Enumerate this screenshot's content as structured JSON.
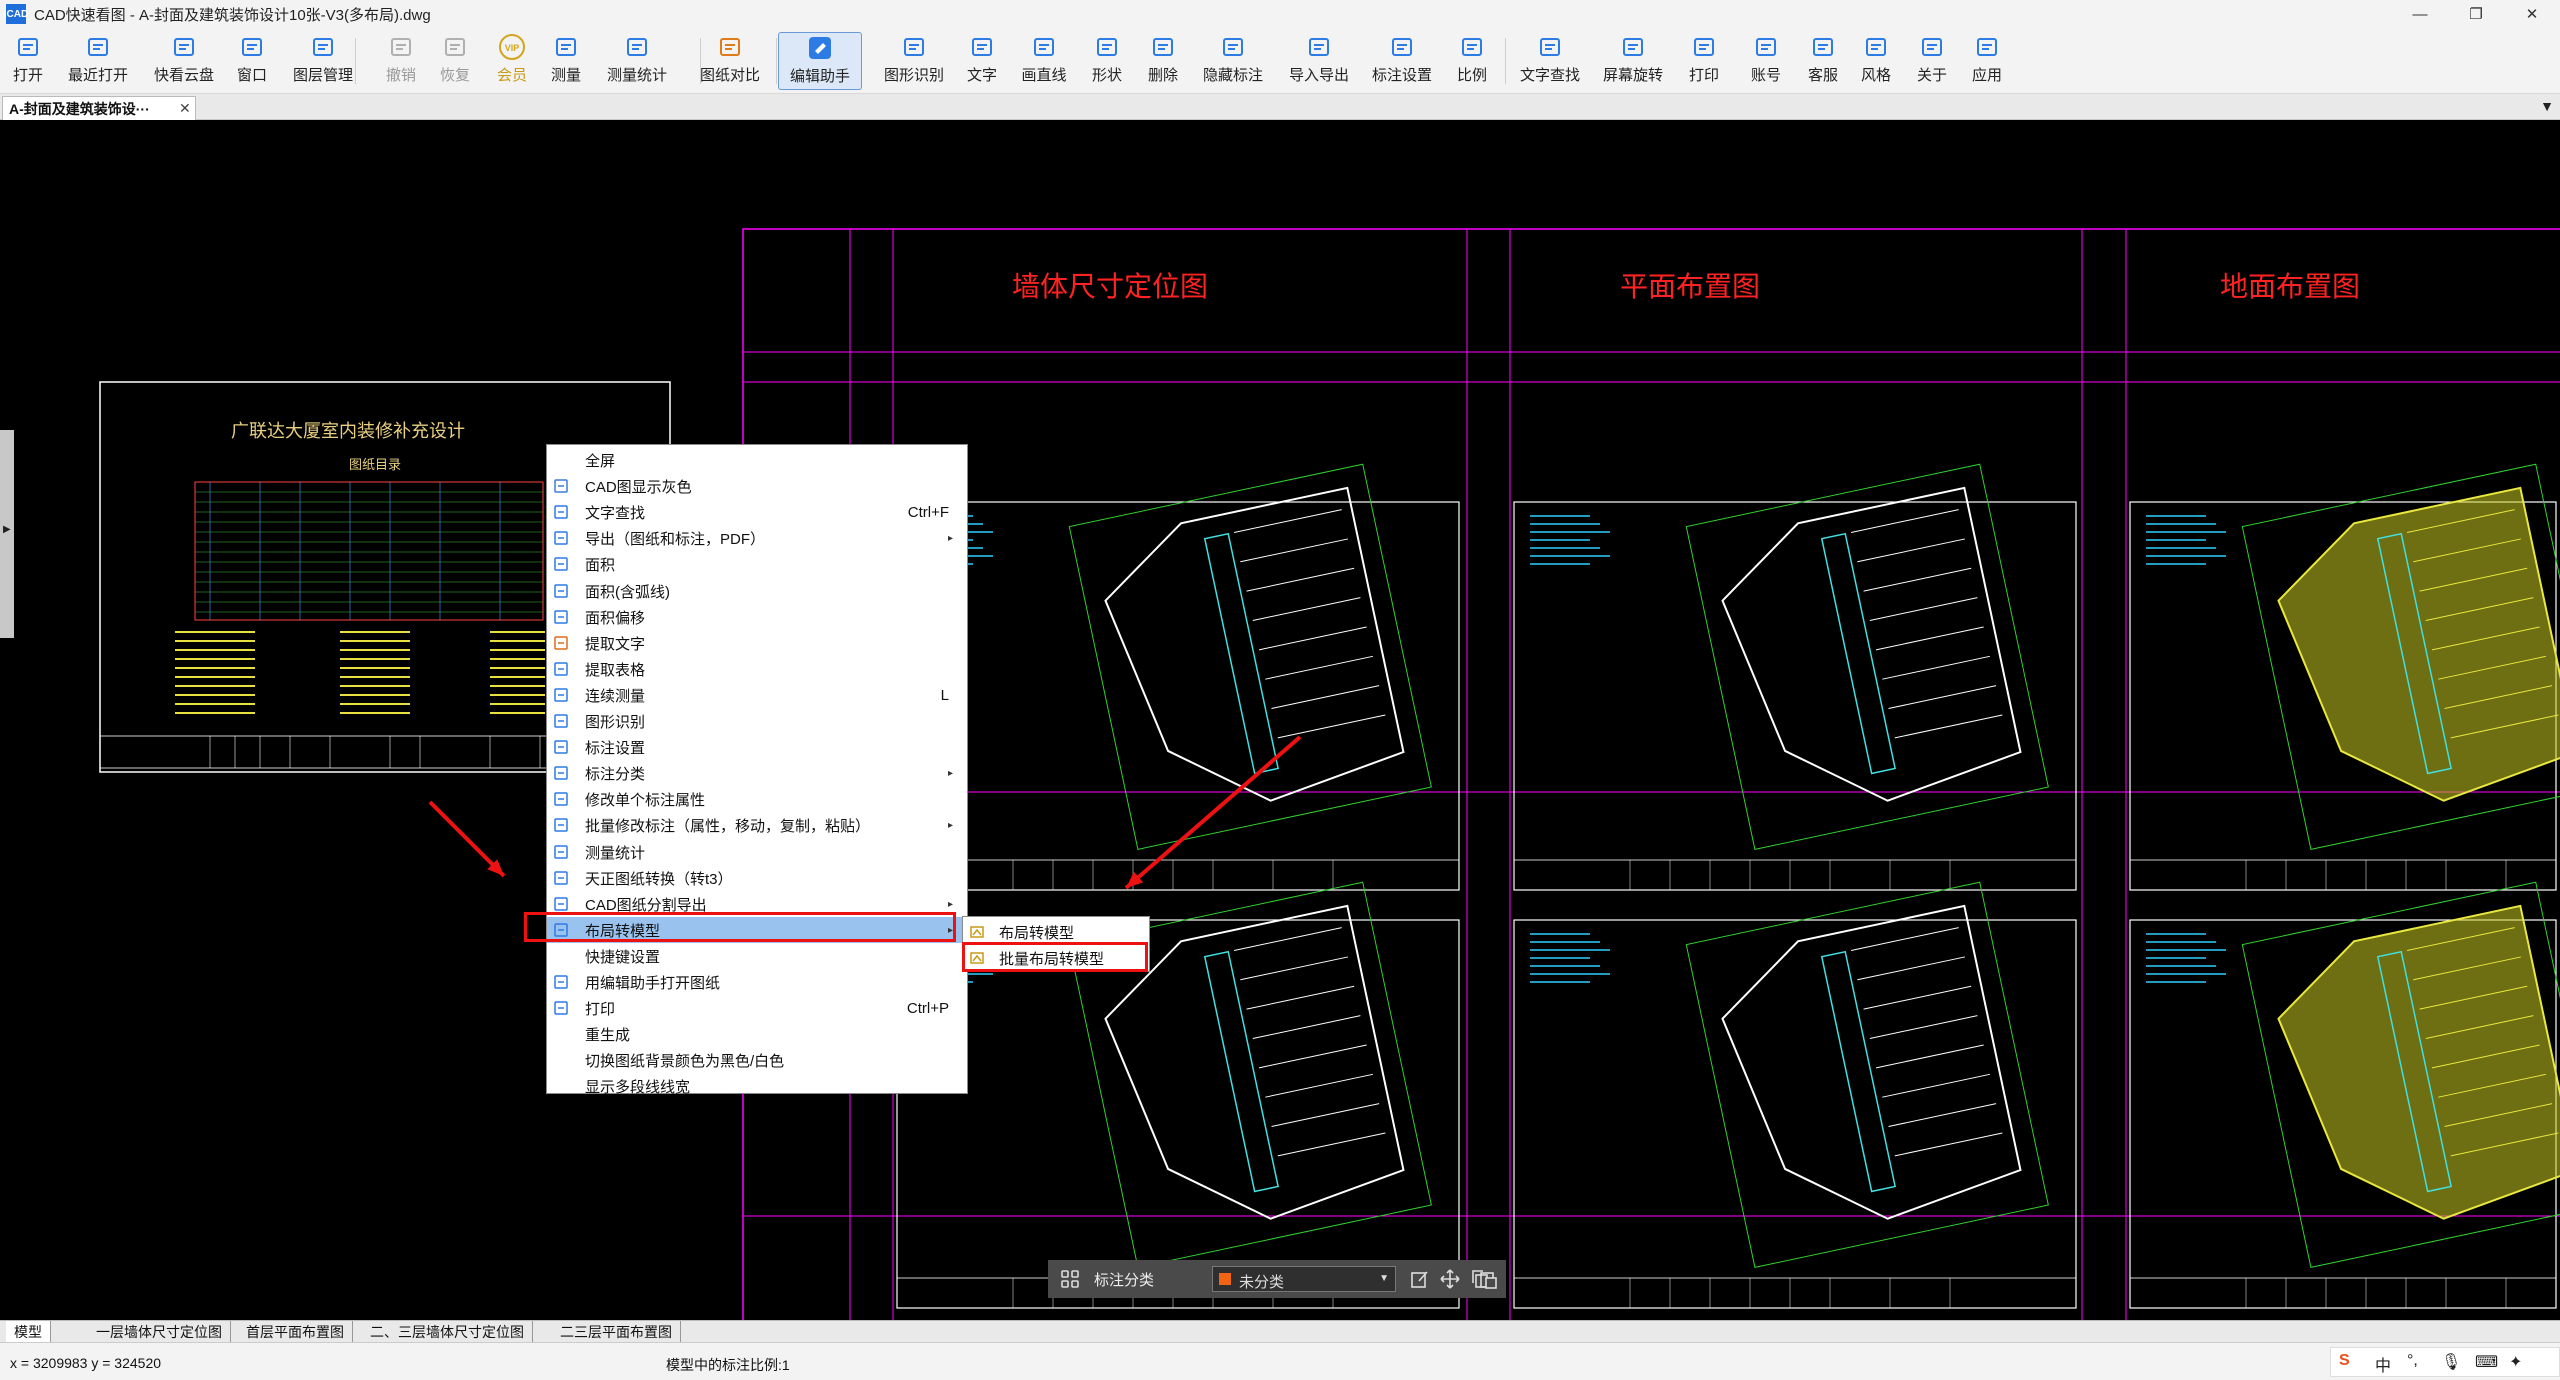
{
  "window": {
    "logo": "ICAD",
    "title": "CAD快速看图 - A-封面及建筑装饰设计10张-V3(多布局).dwg",
    "controls": [
      "—",
      "❐",
      "✕"
    ]
  },
  "toolbar": {
    "items": [
      {
        "label": "打开",
        "icon": "open-folder-icon"
      },
      {
        "label": "最近打开",
        "icon": "recent-icon"
      },
      {
        "label": "快看云盘",
        "icon": "cloud-icon"
      },
      {
        "label": "窗口",
        "icon": "window-icon"
      },
      {
        "label": "图层管理",
        "icon": "layers-icon"
      },
      {
        "label": "撤销",
        "icon": "undo-icon"
      },
      {
        "label": "恢复",
        "icon": "redo-icon"
      },
      {
        "label": "会员",
        "icon": "vip-icon"
      },
      {
        "label": "测量",
        "icon": "ruler-icon"
      },
      {
        "label": "测量统计",
        "icon": "measure-stats-icon"
      },
      {
        "label": "图纸对比",
        "icon": "compare-icon"
      },
      {
        "label": "编辑助手",
        "icon": "edit-assistant-icon"
      },
      {
        "label": "图形识别",
        "icon": "shape-recognize-icon"
      },
      {
        "label": "文字",
        "icon": "text-icon"
      },
      {
        "label": "画直线",
        "icon": "line-icon"
      },
      {
        "label": "形状",
        "icon": "shape-icon"
      },
      {
        "label": "删除",
        "icon": "eraser-icon"
      },
      {
        "label": "隐藏标注",
        "icon": "hide-annotation-icon"
      },
      {
        "label": "导入导出",
        "icon": "import-export-icon"
      },
      {
        "label": "标注设置",
        "icon": "annotation-settings-icon"
      },
      {
        "label": "比例",
        "icon": "scale-icon"
      },
      {
        "label": "文字查找",
        "icon": "text-search-icon"
      },
      {
        "label": "屏幕旋转",
        "icon": "rotate-screen-icon"
      },
      {
        "label": "打印",
        "icon": "print-icon"
      },
      {
        "label": "账号",
        "icon": "account-icon"
      },
      {
        "label": "客服",
        "icon": "headset-icon"
      },
      {
        "label": "风格",
        "icon": "style-icon"
      },
      {
        "label": "关于",
        "icon": "info-icon"
      },
      {
        "label": "应用",
        "icon": "apps-icon"
      }
    ]
  },
  "doc_tab": {
    "label": "A-封面及建筑装饰设···",
    "close": "✕"
  },
  "drawing": {
    "panel_titles": [
      "墙体尺寸定位图",
      "平面布置图",
      "地面布置图"
    ],
    "cover_title": "广联达大厦室内装修补充设计",
    "cover_subtitle": "图纸目录"
  },
  "context_menu": {
    "items": [
      {
        "label": "全屏",
        "shortcut": "",
        "submenu": false,
        "icon": ""
      },
      {
        "label": "CAD图显示灰色",
        "shortcut": "",
        "submenu": false,
        "icon": "cad-gray-icon"
      },
      {
        "label": "文字查找",
        "shortcut": "Ctrl+F",
        "submenu": false,
        "icon": "text-search-icon"
      },
      {
        "label": "导出（图纸和标注，PDF）",
        "shortcut": "",
        "submenu": true,
        "icon": "export-icon"
      },
      {
        "label": "面积",
        "shortcut": "",
        "submenu": false,
        "icon": "area-icon"
      },
      {
        "label": "面积(含弧线)",
        "shortcut": "",
        "submenu": false,
        "icon": "area-arc-icon"
      },
      {
        "label": "面积偏移",
        "shortcut": "",
        "submenu": false,
        "icon": "area-offset-icon"
      },
      {
        "label": "提取文字",
        "shortcut": "",
        "submenu": false,
        "icon": "extract-text-icon"
      },
      {
        "label": "提取表格",
        "shortcut": "",
        "submenu": false,
        "icon": "extract-table-icon"
      },
      {
        "label": "连续测量",
        "shortcut": "L",
        "submenu": false,
        "icon": "continuous-measure-icon"
      },
      {
        "label": "图形识别",
        "shortcut": "",
        "submenu": false,
        "icon": "shape-recognize-icon"
      },
      {
        "label": "标注设置",
        "shortcut": "",
        "submenu": false,
        "icon": "annotation-settings-icon"
      },
      {
        "label": "标注分类",
        "shortcut": "",
        "submenu": true,
        "icon": "annotation-category-icon"
      },
      {
        "label": "修改单个标注属性",
        "shortcut": "",
        "submenu": false,
        "icon": "edit-annotation-icon"
      },
      {
        "label": "批量修改标注（属性，移动，复制，粘贴）",
        "shortcut": "",
        "submenu": true,
        "icon": "batch-edit-icon"
      },
      {
        "label": "测量统计",
        "shortcut": "",
        "submenu": false,
        "icon": "measure-stats-icon"
      },
      {
        "label": "天正图纸转换（转t3）",
        "shortcut": "",
        "submenu": false,
        "icon": "convert-icon"
      },
      {
        "label": "CAD图纸分割导出",
        "shortcut": "",
        "submenu": true,
        "icon": "split-export-icon"
      },
      {
        "label": "布局转模型",
        "shortcut": "",
        "submenu": true,
        "icon": "layout-to-model-icon",
        "highlighted": true
      },
      {
        "label": "快捷键设置",
        "shortcut": "",
        "submenu": false,
        "icon": ""
      },
      {
        "label": "用编辑助手打开图纸",
        "shortcut": "",
        "submenu": false,
        "icon": "edit-assistant-icon"
      },
      {
        "label": "打印",
        "shortcut": "Ctrl+P",
        "submenu": false,
        "icon": "print-icon"
      },
      {
        "label": "重生成",
        "shortcut": "",
        "submenu": false,
        "icon": ""
      },
      {
        "label": "切换图纸背景颜色为黑色/白色",
        "shortcut": "",
        "submenu": false,
        "icon": ""
      },
      {
        "label": "显示多段线线宽",
        "shortcut": "",
        "submenu": false,
        "icon": ""
      }
    ]
  },
  "submenu": {
    "items": [
      {
        "label": "布局转模型",
        "icon": "layout-to-model-icon"
      },
      {
        "label": "批量布局转模型",
        "icon": "batch-layout-to-model-icon"
      }
    ]
  },
  "annotation_bar": {
    "label": "标注分类",
    "value": "未分类",
    "swatch_color": "#f06414"
  },
  "layout_tabs": [
    "模型",
    "一层墙体尺寸定位图",
    "首层平面布置图",
    "二、三层墙体尺寸定位图",
    "二三层平面布置图"
  ],
  "status": {
    "coords": "x = 3209983  y = 324520",
    "scale_text": "模型中的标注比例:1"
  },
  "ime": {
    "lang": "中"
  },
  "colors": {
    "highlight": "#99c3ee",
    "callout": "#e11111",
    "frame": "#ff00ff",
    "title_red": "#ff2222"
  }
}
